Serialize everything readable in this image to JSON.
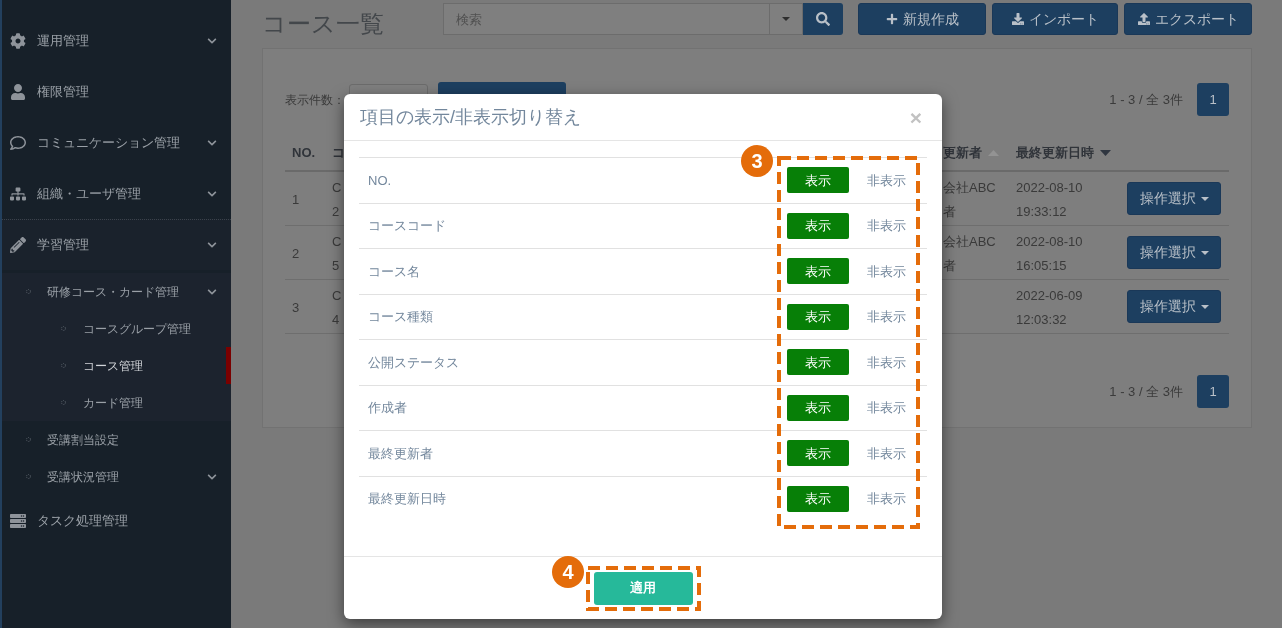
{
  "sidebar": {
    "items": [
      {
        "label": "運用管理",
        "expandable": true,
        "selected": false
      },
      {
        "label": "権限管理",
        "expandable": false,
        "selected": false
      },
      {
        "label": "コミュニケーション管理",
        "expandable": true,
        "selected": false
      },
      {
        "label": "組織・ユーザ管理",
        "expandable": true,
        "selected": false
      },
      {
        "label": "学習管理",
        "expandable": true,
        "selected": false,
        "children": [
          {
            "label": "研修コース・カード管理",
            "expandable": true,
            "selected": false,
            "children": [
              {
                "label": "コースグループ管理",
                "expandable": false,
                "selected": false
              },
              {
                "label": "コース管理",
                "expandable": false,
                "selected": true
              },
              {
                "label": "カード管理",
                "expandable": false,
                "selected": false
              }
            ]
          },
          {
            "label": "受講割当設定",
            "expandable": false,
            "selected": false
          },
          {
            "label": "受講状況管理",
            "expandable": true,
            "selected": false
          }
        ]
      },
      {
        "label": "タスク処理管理",
        "expandable": false,
        "selected": false
      }
    ]
  },
  "header": {
    "title": "コース一覧",
    "search": {
      "placeholder": "検索"
    },
    "buttons": [
      {
        "label": "新規作成"
      },
      {
        "label": "インポート"
      },
      {
        "label": "エクスポート"
      }
    ]
  },
  "panel": {
    "page_size_label": "表示件数：",
    "pagination_top": {
      "summary": "1 - 3 / 全 3件",
      "pages": [
        {
          "label": "1",
          "selected": true
        }
      ]
    },
    "table": {
      "columns": [
        {
          "label": "NO."
        },
        {
          "label": "コ"
        },
        {
          "label": "更新者",
          "sort_ascending": true,
          "sort_active": false
        },
        {
          "label": "最終更新日時",
          "sort_ascending": false,
          "sort_active": true
        }
      ],
      "rows": [
        {
          "no": "1",
          "column_2": [
            "C",
            "2"
          ],
          "updater": [
            "会社ABC",
            "者"
          ],
          "updated_at": [
            "2022-08-10",
            "19:33:12"
          ],
          "action": "操作選択"
        },
        {
          "no": "2",
          "column_2": [
            "C",
            "5"
          ],
          "updater": [
            "会社ABC",
            "者"
          ],
          "updated_at": [
            "2022-08-10",
            "16:05:15"
          ],
          "action": "操作選択"
        },
        {
          "no": "3",
          "column_2": [
            "C",
            "4"
          ],
          "updated_at": [
            "2022-06-09",
            "12:03:32"
          ],
          "action": "操作選択"
        }
      ]
    },
    "pagination_bottom": {
      "summary": "1 - 3 / 全 3件",
      "pages": [
        {
          "label": "1",
          "selected": true
        }
      ]
    }
  },
  "modal": {
    "title": "項目の表示/非表示切り替え",
    "close_label": "×",
    "rows": [
      {
        "label": "NO.",
        "options": [
          {
            "label": "表示",
            "selected": true
          },
          {
            "label": "非表示",
            "selected": false
          }
        ]
      },
      {
        "label": "コースコード",
        "options": [
          {
            "label": "表示",
            "selected": true
          },
          {
            "label": "非表示",
            "selected": false
          }
        ]
      },
      {
        "label": "コース名",
        "options": [
          {
            "label": "表示",
            "selected": true
          },
          {
            "label": "非表示",
            "selected": false
          }
        ]
      },
      {
        "label": "コース種類",
        "options": [
          {
            "label": "表示",
            "selected": true
          },
          {
            "label": "非表示",
            "selected": false
          }
        ]
      },
      {
        "label": "公開ステータス",
        "options": [
          {
            "label": "表示",
            "selected": true
          },
          {
            "label": "非表示",
            "selected": false
          }
        ]
      },
      {
        "label": "作成者",
        "options": [
          {
            "label": "表示",
            "selected": true
          },
          {
            "label": "非表示",
            "selected": false
          }
        ]
      },
      {
        "label": "最終更新者",
        "options": [
          {
            "label": "表示",
            "selected": true
          },
          {
            "label": "非表示",
            "selected": false
          }
        ]
      },
      {
        "label": "最終更新日時",
        "options": [
          {
            "label": "表示",
            "selected": true
          },
          {
            "label": "非表示",
            "selected": false
          }
        ]
      }
    ],
    "apply_label": "適用",
    "toggle_annotation": {
      "label": "3"
    },
    "apply_annotation": {
      "label": "4"
    }
  }
}
